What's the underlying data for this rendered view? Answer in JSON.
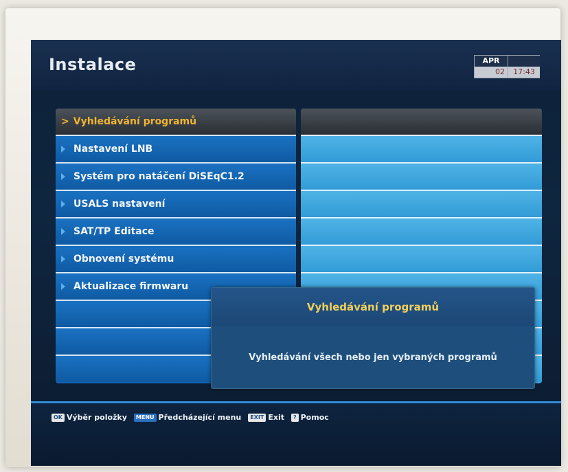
{
  "header": {
    "title": "Instalace",
    "clock": {
      "month": "APR",
      "day": "02",
      "time": "17:43"
    }
  },
  "menu": {
    "selected": "Vyhledávání programů",
    "items": [
      "Nastavení LNB",
      "Systém pro natáčení DiSEqC1.2",
      "USALS nastavení",
      "SAT/TP Editace",
      "Obnovení systému",
      "Aktualizace firmwaru"
    ]
  },
  "info_popup": {
    "title": "Vyhledávání programů",
    "description": "Vyhledávání všech nebo jen vybraných programů"
  },
  "footer": {
    "hints": [
      {
        "key": "OK",
        "label": "Výběr položky"
      },
      {
        "key": "MENU",
        "label": "Předcházející menu"
      },
      {
        "key": "EXIT",
        "label": "Exit"
      },
      {
        "key": "?",
        "label": "Pomoc"
      }
    ]
  },
  "colors": {
    "accent": "#f2b531",
    "menu_bg": "#1466b4",
    "panel_bg": "#3ea7e0",
    "popup_bg": "#1e4f7c"
  }
}
